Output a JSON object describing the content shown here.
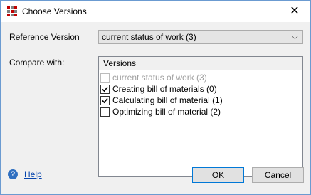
{
  "window": {
    "title": "Choose Versions",
    "close_glyph": "✕",
    "icon": "app-grid-icon",
    "icon_colors": [
      "#c00000",
      "#808080",
      "#c00000",
      "#808080",
      "#c00000",
      "#808080",
      "#c00000",
      "#808080",
      "#c00000"
    ]
  },
  "reference": {
    "label": "Reference Version",
    "value": "current status of work (3)"
  },
  "compare": {
    "label": "Compare with:"
  },
  "versions": {
    "header": "Versions",
    "items": [
      {
        "label": "current status of work (3)",
        "checked": false,
        "disabled": true
      },
      {
        "label": "Creating bill of materials (0)",
        "checked": true,
        "disabled": false
      },
      {
        "label": "Calculating bill of material (1)",
        "checked": true,
        "disabled": false
      },
      {
        "label": "Optimizing bill of material (2)",
        "checked": false,
        "disabled": false
      }
    ]
  },
  "footer": {
    "help_icon": "question-icon",
    "help_glyph": "?",
    "help_label": "Help",
    "ok_label": "OK",
    "cancel_label": "Cancel"
  }
}
